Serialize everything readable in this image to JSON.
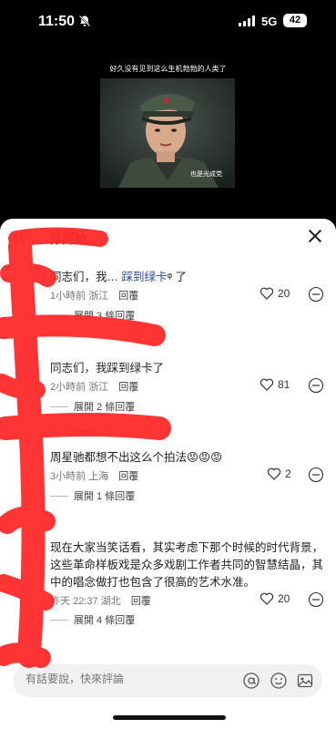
{
  "status_bar": {
    "time": "11:50",
    "network": "5G",
    "battery": "42"
  },
  "video": {
    "caption_top": "好久没有见到这么生机勃勃的人类了",
    "subtitle": "也是光成党"
  },
  "sheet": {
    "title_visible": "共",
    "title_suffix": "條評論"
  },
  "comments": [
    {
      "text_pre": "同志们，我… ",
      "text_highlight": "踩到绿卡",
      "text_post": "ᵠ 了",
      "time": "1小時前",
      "location": "浙江",
      "reply_label": "回覆",
      "likes": "20",
      "expand": "展開 3 條回覆"
    },
    {
      "text_pre": "同志们，我踩到绿卡了",
      "text_highlight": "",
      "text_post": "",
      "time": "2小時前",
      "location": "浙江",
      "reply_label": "回覆",
      "likes": "81",
      "expand": "展開 2 條回覆"
    },
    {
      "text_pre": "周星驰都想不出这么个拍法",
      "text_highlight": "",
      "text_post": "",
      "emojis": "😡😡😡",
      "time": "3小時前",
      "location": "上海",
      "reply_label": "回覆",
      "likes": "2",
      "expand": "展開 1 條回覆"
    },
    {
      "text_pre": "现在大家当笑话看，其实考虑下那个时候的时代背景，这些革命样板戏是众多戏剧工作者共同的智慧结晶，其中的唱念做打也包含了很高的艺术水准。",
      "text_highlight": "",
      "text_post": "",
      "time": "昨天 22:37",
      "location": "湖北",
      "reply_label": "回覆",
      "likes": "20",
      "expand": "展開 4 條回覆"
    }
  ],
  "input": {
    "placeholder": "有話要說，快來評論"
  },
  "colors": {
    "scribble": "#ff2d2d",
    "sheet_bg": "#ffffff",
    "link": "#2a4a9a"
  },
  "icons": [
    "bell-muted-icon",
    "heart-icon",
    "more-icon",
    "close-icon",
    "at-icon",
    "emoji-icon",
    "image-icon"
  ]
}
